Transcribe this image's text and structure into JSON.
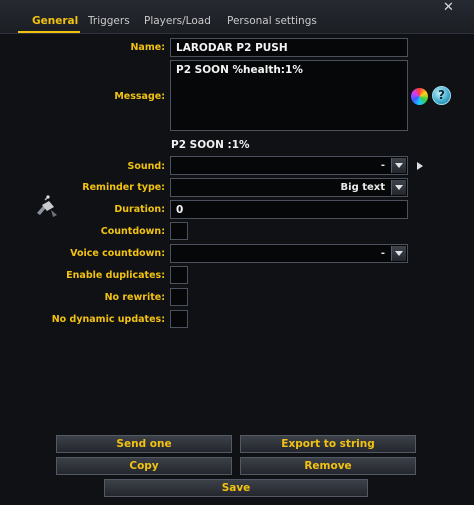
{
  "tabs": [
    {
      "label": "General"
    },
    {
      "label": "Triggers"
    },
    {
      "label": "Players/Load"
    },
    {
      "label": "Personal settings"
    }
  ],
  "close_glyph": "✕",
  "form": {
    "name_label": "Name:",
    "name_value": "LARODAR P2 PUSH",
    "message_label": "Message:",
    "message_value": "P2 SOON %health:1%",
    "message_preview": "P2 SOON :1%",
    "sound_label": "Sound:",
    "sound_value": "-",
    "reminder_type_label": "Reminder type:",
    "reminder_type_value": "Big text",
    "duration_label": "Duration:",
    "duration_value": "0",
    "countdown_label": "Countdown:",
    "voice_countdown_label": "Voice countdown:",
    "voice_countdown_value": "-",
    "enable_duplicates_label": "Enable duplicates:",
    "no_rewrite_label": "No rewrite:",
    "no_dynamic_updates_label": "No dynamic updates:"
  },
  "icons": {
    "color_picker": "color-wheel-icon",
    "help": "help-icon",
    "help_glyph": "?",
    "play_sound": "play-icon",
    "reminder_graphic": "antenna-icon"
  },
  "buttons": {
    "send_one": "Send one",
    "export_to_string": "Export to string",
    "copy": "Copy",
    "remove": "Remove",
    "save": "Save"
  },
  "colors": {
    "accent": "#f2c211",
    "background": "#0f1114",
    "field_background": "#060708"
  }
}
